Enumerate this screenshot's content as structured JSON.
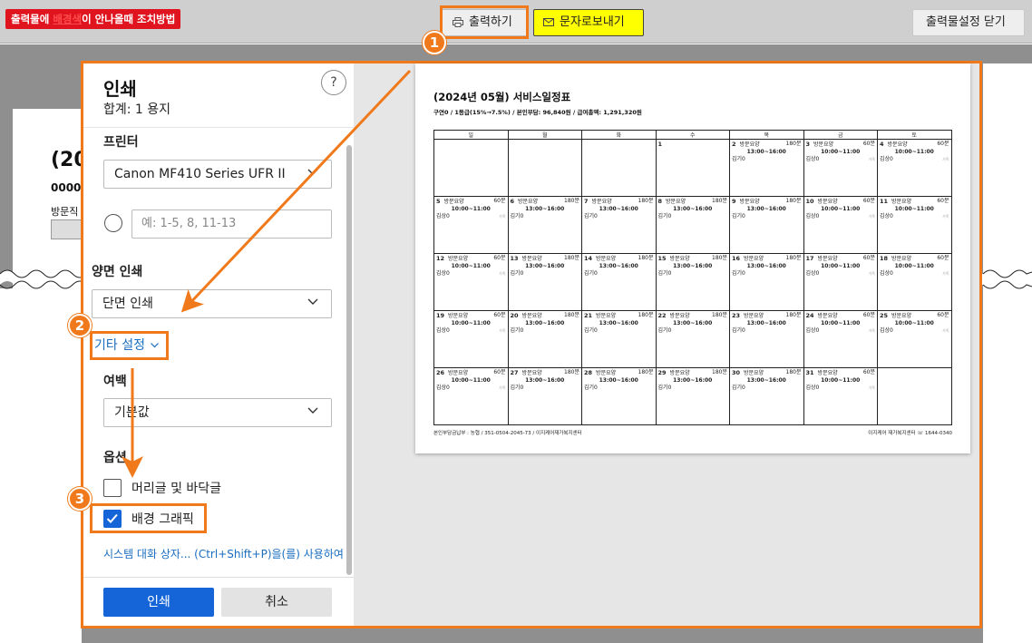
{
  "topbar": {
    "alert_pre": "출력물에 ",
    "alert_hl": "배경색",
    "alert_post": "이 안나올때 조치방법",
    "print_label": "출력하기",
    "sms_label": "문자로보내기",
    "close_label": "출력물설정 닫기"
  },
  "background_page": {
    "title": "(20",
    "number": "0000",
    "label": "방문직"
  },
  "dialog": {
    "title": "인쇄",
    "subtitle": "합계: 1 용지",
    "help": "?",
    "printer_label": "프린터",
    "printer_value": "Canon MF410 Series UFR II",
    "pages_placeholder": "예: 1-5, 8, 11-13",
    "duplex_label": "양면 인쇄",
    "duplex_value": "단면 인쇄",
    "more_settings": "기타 설정",
    "margin_label": "여백",
    "margin_value": "기본값",
    "options_label": "옵션",
    "option_header_footer": "머리글 및 바닥글",
    "option_header_footer_checked": false,
    "option_background": "배경 그래픽",
    "option_background_checked": true,
    "system_dialog_link": "시스템 대화 상자... (Ctrl+Shift+P)을(를) 사용하여",
    "print_button": "인쇄",
    "cancel_button": "취소"
  },
  "preview": {
    "title": "(2024년 05월) 서비스일정표",
    "subtitle": "구연0 / 1등급(15%→7.5%) / 본인부담: 96,840원 / 급여총액: 1,291,320원",
    "weekdays": [
      "일",
      "월",
      "화",
      "수",
      "목",
      "금",
      "토"
    ],
    "weeks": [
      [
        {
          "day": "",
          "time": "",
          "who": ""
        },
        {
          "day": "",
          "time": "",
          "who": ""
        },
        {
          "day": "",
          "time": "",
          "who": ""
        },
        {
          "day": "1",
          "time": "",
          "who": ""
        },
        {
          "day": "2",
          "svc": "방문요양",
          "min": "180분",
          "time": "13:00~16:00",
          "who": "김기0"
        },
        {
          "day": "3",
          "svc": "방문요양",
          "min": "60분",
          "time": "10:00~11:00",
          "who": "김상0",
          "mark": "가족"
        },
        {
          "day": "4",
          "svc": "방문요양",
          "min": "60분",
          "time": "10:00~11:00",
          "who": "김상0",
          "mark": "가족"
        }
      ],
      [
        {
          "day": "5",
          "svc": "방문요양",
          "min": "60분",
          "time": "10:00~11:00",
          "who": "김상0",
          "mark": "가족"
        },
        {
          "day": "6",
          "svc": "방문요양",
          "min": "180분",
          "time": "13:00~16:00",
          "who": "김기0"
        },
        {
          "day": "7",
          "svc": "방문요양",
          "min": "180분",
          "time": "13:00~16:00",
          "who": "김기0"
        },
        {
          "day": "8",
          "svc": "방문요양",
          "min": "180분",
          "time": "13:00~16:00",
          "who": "김기0"
        },
        {
          "day": "9",
          "svc": "방문요양",
          "min": "180분",
          "time": "13:00~16:00",
          "who": "김기0"
        },
        {
          "day": "10",
          "svc": "방문요양",
          "min": "60분",
          "time": "10:00~11:00",
          "who": "김상0",
          "mark": "가족"
        },
        {
          "day": "11",
          "svc": "방문요양",
          "min": "60분",
          "time": "10:00~11:00",
          "who": "김상0",
          "mark": "가족"
        }
      ],
      [
        {
          "day": "12",
          "svc": "방문요양",
          "min": "60분",
          "time": "10:00~11:00",
          "who": "김상0",
          "mark": "가족"
        },
        {
          "day": "13",
          "svc": "방문요양",
          "min": "180분",
          "time": "13:00~16:00",
          "who": "김기0"
        },
        {
          "day": "14",
          "svc": "방문요양",
          "min": "180분",
          "time": "13:00~16:00",
          "who": "김기0"
        },
        {
          "day": "15",
          "svc": "방문요양",
          "min": "180분",
          "time": "13:00~16:00",
          "who": "김기0"
        },
        {
          "day": "16",
          "svc": "방문요양",
          "min": "180분",
          "time": "13:00~16:00",
          "who": "김기0"
        },
        {
          "day": "17",
          "svc": "방문요양",
          "min": "60분",
          "time": "10:00~11:00",
          "who": "김상0",
          "mark": "가족"
        },
        {
          "day": "18",
          "svc": "방문요양",
          "min": "60분",
          "time": "10:00~11:00",
          "who": "김상0",
          "mark": "가족"
        }
      ],
      [
        {
          "day": "19",
          "svc": "방문요양",
          "min": "60분",
          "time": "10:00~11:00",
          "who": "김상0",
          "mark": "가족"
        },
        {
          "day": "20",
          "svc": "방문요양",
          "min": "180분",
          "time": "13:00~16:00",
          "who": "김기0"
        },
        {
          "day": "21",
          "svc": "방문요양",
          "min": "180분",
          "time": "13:00~16:00",
          "who": "김기0"
        },
        {
          "day": "22",
          "svc": "방문요양",
          "min": "180분",
          "time": "13:00~16:00",
          "who": "김기0"
        },
        {
          "day": "23",
          "svc": "방문요양",
          "min": "180분",
          "time": "13:00~16:00",
          "who": "김기0"
        },
        {
          "day": "24",
          "svc": "방문요양",
          "min": "60분",
          "time": "10:00~11:00",
          "who": "김상0",
          "mark": "가족"
        },
        {
          "day": "25",
          "svc": "방문요양",
          "min": "60분",
          "time": "10:00~11:00",
          "who": "김상0",
          "mark": "가족"
        }
      ],
      [
        {
          "day": "26",
          "svc": "방문요양",
          "min": "60분",
          "time": "10:00~11:00",
          "who": "김상0",
          "mark": "가족"
        },
        {
          "day": "27",
          "svc": "방문요양",
          "min": "180분",
          "time": "13:00~16:00",
          "who": "김기0"
        },
        {
          "day": "28",
          "svc": "방문요양",
          "min": "180분",
          "time": "13:00~16:00",
          "who": "김기0"
        },
        {
          "day": "29",
          "svc": "방문요양",
          "min": "180분",
          "time": "13:00~16:00",
          "who": "김기0"
        },
        {
          "day": "30",
          "svc": "방문요양",
          "min": "180분",
          "time": "13:00~16:00",
          "who": "김기0"
        },
        {
          "day": "31",
          "svc": "방문요양",
          "min": "60분",
          "time": "10:00~11:00",
          "who": "김상0",
          "mark": "가족"
        },
        {
          "day": "",
          "time": "",
          "who": ""
        }
      ]
    ],
    "footer_left": "본인부담금납부 : 농협 / 351-0504-2045-73 / 이지케어재가복지센터",
    "footer_right": "이지케어 재가복지센터 ☏ 1644-0340"
  },
  "annotations": {
    "step1": "1",
    "step2": "2",
    "step3": "3",
    "accent": "#f07a1b"
  },
  "icons": {
    "print": "printer-icon",
    "sms": "envelope-icon",
    "chevron": "chevron-down-icon",
    "check": "checkmark-icon"
  }
}
